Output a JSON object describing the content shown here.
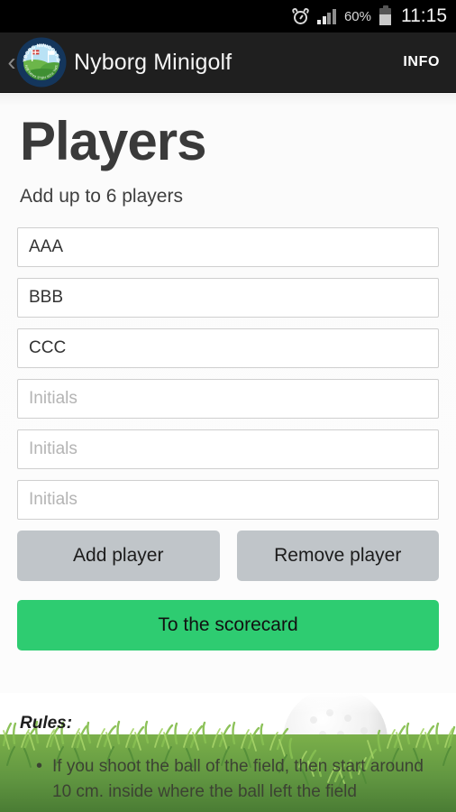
{
  "status_bar": {
    "alarm_icon": "alarm-clock-icon",
    "signal_icon": "cellular-signal-icon",
    "signal_bars_filled": 2,
    "signal_bars_total": 4,
    "battery_percent": "60%",
    "battery_level": 60,
    "battery_icon": "battery-icon",
    "time": "11:15"
  },
  "app_bar": {
    "back_icon": "‹",
    "logo_icon": "nyborg-minigolf-logo",
    "logo_text_top": "NYBORG MINIGOLF.DK",
    "title": "Nyborg Minigolf",
    "info_label": "INFO"
  },
  "page": {
    "title": "Players",
    "subtitle": "Add up to 6 players"
  },
  "player_fields": [
    {
      "value": "AAA",
      "placeholder": "Initials"
    },
    {
      "value": "BBB",
      "placeholder": "Initials"
    },
    {
      "value": "CCC",
      "placeholder": "Initials"
    },
    {
      "value": "",
      "placeholder": "Initials"
    },
    {
      "value": "",
      "placeholder": "Initials"
    },
    {
      "value": "",
      "placeholder": "Initials"
    }
  ],
  "buttons": {
    "add_player": "Add player",
    "remove_player": "Remove player",
    "to_scorecard": "To the scorecard"
  },
  "rules": {
    "heading": "Rules:",
    "items": [
      "If you shoot the ball of the field, then start around 10 cm. inside where the ball left the field"
    ]
  },
  "colors": {
    "status_bar_bg": "#000000",
    "app_bar_bg": "#1f1f1f",
    "content_bg": "#fbfbfb",
    "primary_green": "#2ECC71",
    "secondary_gray": "#c0c5c9",
    "field_border": "#cfcfcf",
    "title_text": "#3a3a3a",
    "placeholder_text": "#b4b4b4"
  }
}
